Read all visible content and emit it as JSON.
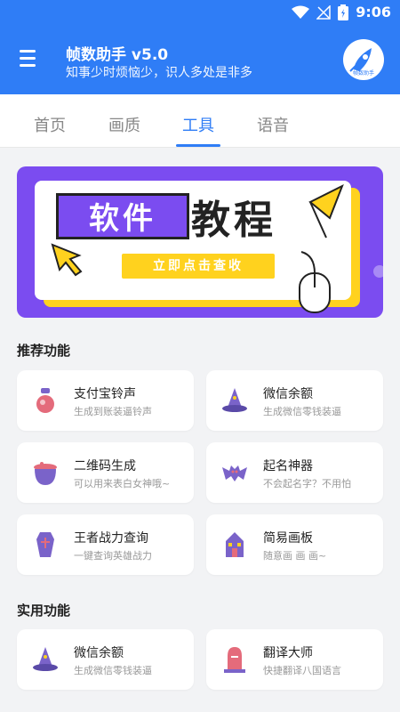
{
  "status_bar": {
    "time": "9:06"
  },
  "app_bar": {
    "title": "帧数助手 v5.0",
    "subtitle": "知事少时烦恼少，识人多处是非多",
    "avatar_label": "帧数助手"
  },
  "tabs": [
    {
      "label": "首页"
    },
    {
      "label": "画质"
    },
    {
      "label": "工具"
    },
    {
      "label": "语音"
    }
  ],
  "active_tab": "工具",
  "banner": {
    "word1": "软件",
    "word2": "教程",
    "cta": "立即点击查收"
  },
  "sections": [
    {
      "title": "推荐功能",
      "items": [
        {
          "title": "支付宝铃声",
          "desc": "生成到账装逼铃声",
          "icon": "gourd-icon"
        },
        {
          "title": "微信余额",
          "desc": "生成微信零钱装逼",
          "icon": "wizard-hat-icon"
        },
        {
          "title": "二维码生成",
          "desc": "可以用来表白女神哦~",
          "icon": "cauldron-icon"
        },
        {
          "title": "起名神器",
          "desc": "不会起名字？不用怕",
          "icon": "bat-icon"
        },
        {
          "title": "王者战力查询",
          "desc": "一键查询英雄战力",
          "icon": "coffin-icon"
        },
        {
          "title": "简易画板",
          "desc": "随意画 画 画~",
          "icon": "haunted-house-icon"
        }
      ]
    },
    {
      "title": "实用功能",
      "items": [
        {
          "title": "微信余额",
          "desc": "生成微信零钱装逼",
          "icon": "wizard-hat-icon"
        },
        {
          "title": "翻译大师",
          "desc": "快捷翻译八国语言",
          "icon": "tombstone-icon"
        }
      ]
    }
  ],
  "colors": {
    "primary": "#2f7df6",
    "banner_purple": "#7b4cf0",
    "banner_yellow": "#ffd21e",
    "icon_purple": "#7a63c9",
    "icon_pink": "#e46b7b"
  }
}
